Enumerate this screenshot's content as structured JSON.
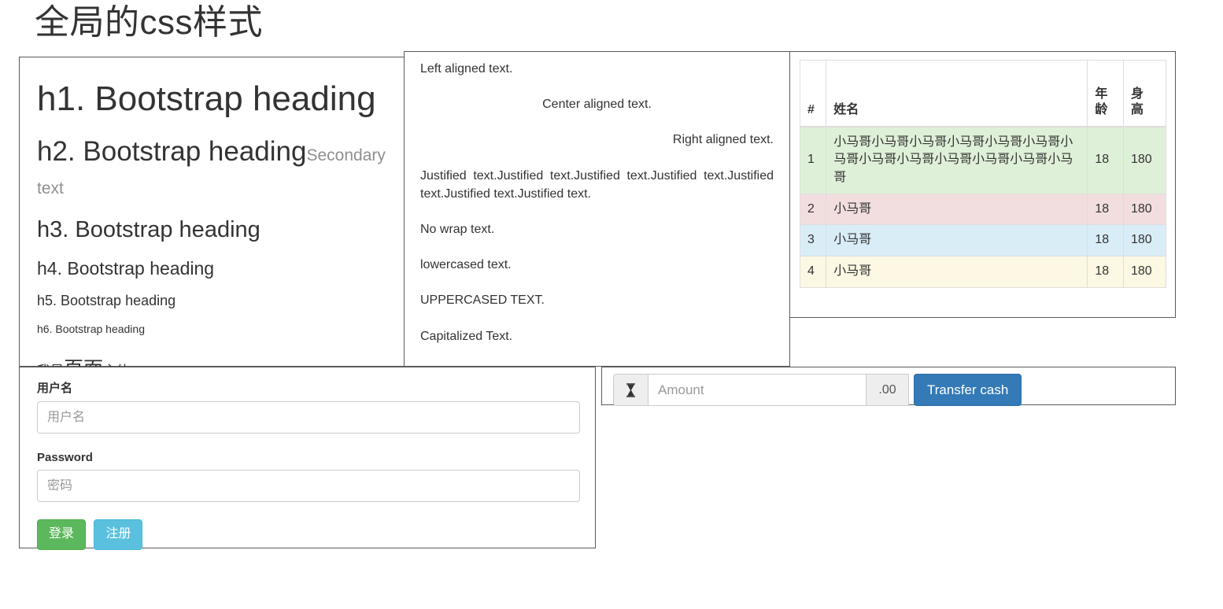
{
  "page": {
    "title": "全局的css样式"
  },
  "typography": {
    "h1": "h1. Bootstrap heading",
    "h2": "h2. Bootstrap heading",
    "h2_secondary": "Secondary text",
    "h3": "h3. Bootstrap heading",
    "h4": "h4. Bootstrap heading",
    "h5": "h5. Bootstrap heading",
    "h6": "h6. Bootstrap heading",
    "body_lead": {
      "prefix": "我是",
      "emphasis": "页面",
      "suffix": "主体"
    }
  },
  "alignment": {
    "left": "Left aligned text.",
    "center": "Center aligned text.",
    "right": "Right aligned text.",
    "justified": "Justified text.Justified text.Justified text.Justified text.Justified text.Justified text.Justified text.",
    "nowrap": "No wrap text.",
    "lowercase": "Lowercased text.",
    "uppercase": "Uppercased text.",
    "capitalize": "capitalized text."
  },
  "table": {
    "headers": {
      "index": "#",
      "name": "姓名",
      "age": "年龄",
      "height": "身高"
    },
    "rows": [
      {
        "index": "1",
        "name": "小马哥小马哥小马哥小马哥小马哥小马哥小马哥小马哥小马哥小马哥小马哥小马哥小马哥",
        "age": "18",
        "height": "180",
        "state": "success"
      },
      {
        "index": "2",
        "name": "小马哥",
        "age": "18",
        "height": "180",
        "state": "danger"
      },
      {
        "index": "3",
        "name": "小马哥",
        "age": "18",
        "height": "180",
        "state": "info"
      },
      {
        "index": "4",
        "name": "小马哥",
        "age": "18",
        "height": "180",
        "state": "warning"
      }
    ]
  },
  "form": {
    "username_label": "用户名",
    "username_placeholder": "用户名",
    "username_value": "",
    "password_label": "Password",
    "password_placeholder": "密码",
    "password_value": "",
    "login_button": "登录",
    "register_button": "注册"
  },
  "input_group": {
    "icon": "hourglass-icon",
    "icon_glyph": "⧗",
    "amount_placeholder": "Amount",
    "amount_value": "",
    "decimal_addon": ".00",
    "transfer_button": "Transfer cash"
  },
  "colors": {
    "success": "#5cb85c",
    "info": "#5bc0de",
    "primary": "#337ab7",
    "row_success": "#dff0d8",
    "row_danger": "#f2dede",
    "row_info": "#d9edf7",
    "row_warning": "#fcf8e3",
    "muted": "#777777"
  }
}
